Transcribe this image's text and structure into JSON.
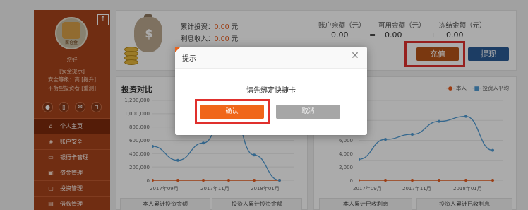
{
  "colors": {
    "sidebar": "#a8431b",
    "accent_orange": "#f0661a",
    "danger_red": "#e0302d",
    "withdraw_blue": "#2a5c96",
    "series_self": "#e85a1c",
    "series_avg": "#4f9bd4"
  },
  "sidebar": {
    "avatar_text": "聚仓金",
    "greeting": "您好",
    "security_notice": "[安全提示]",
    "security_level": "安全等级：高 [提升]",
    "investor_type": "平衡型投资者 [重测]",
    "quick_icons": [
      "user-icon",
      "phone-icon",
      "mail-icon",
      "lock-icon"
    ],
    "menu": [
      {
        "label": "个人主页",
        "icon": "home-icon",
        "active": true
      },
      {
        "label": "账户安全",
        "icon": "shield-icon",
        "active": false
      },
      {
        "label": "银行卡管理",
        "icon": "card-icon",
        "active": false
      },
      {
        "label": "资金管理",
        "icon": "wallet-icon",
        "active": false
      },
      {
        "label": "投资管理",
        "icon": "monitor-icon",
        "active": false
      },
      {
        "label": "借款管理",
        "icon": "doc-icon",
        "active": false
      }
    ]
  },
  "summary": {
    "cumulative_label": "累计投资：",
    "cumulative_value": "0.00",
    "interest_label": "利息收入：",
    "interest_value": "0.00",
    "unit": "元"
  },
  "account": {
    "balance_label": "账户余额（元）",
    "available_label": "可用金额（元）",
    "frozen_label": "冻结金额（元）",
    "balance": "0.00",
    "available": "0.00",
    "frozen": "0.00",
    "eq": "=",
    "plus": "+",
    "recharge_label": "充值",
    "withdraw_label": "提现"
  },
  "chart_left": {
    "title": "投资对比",
    "footer_tabs": [
      "本人累计投资金额",
      "投资人累计投资金额"
    ]
  },
  "chart_right": {
    "footer_tabs": [
      "本人累计已收利息",
      "投资人累计已收利息"
    ]
  },
  "legend": {
    "self": "本人",
    "avg": "投资人平均"
  },
  "chart_data": [
    {
      "type": "line",
      "x": [
        "2017年09月",
        "2017年10月",
        "2017年11月",
        "2017年12月",
        "2018年01月",
        "2018年02月"
      ],
      "tick_x": [
        "2017年09月",
        "2017年11月",
        "2018年01月"
      ],
      "yticks": [
        "1,200,000",
        "1,000,000",
        "800,000",
        "600,000",
        "400,000",
        "200,000",
        "0"
      ],
      "ylim": [
        0,
        1200000
      ],
      "series": [
        {
          "name": "本人",
          "values": [
            0,
            0,
            0,
            0,
            0,
            0
          ]
        },
        {
          "name": "投资人平均",
          "values": [
            510000,
            300000,
            560000,
            1150000,
            380000,
            0
          ]
        }
      ]
    },
    {
      "type": "line",
      "x": [
        "2017年09月",
        "2017年10月",
        "2017年11月",
        "2017年12月",
        "2018年01月",
        "2018年02月"
      ],
      "tick_x": [
        "2017年09月",
        "2017年11月",
        "2018年01月"
      ],
      "yticks": [
        "6,000",
        "4,000",
        "2,000",
        "0"
      ],
      "ylim": [
        0,
        8000
      ],
      "series": [
        {
          "name": "本人",
          "values": [
            0,
            0,
            0,
            0,
            0,
            0
          ]
        },
        {
          "name": "投资人平均",
          "values": [
            2100,
            4100,
            4600,
            5900,
            6400,
            3000
          ]
        }
      ]
    }
  ],
  "modal": {
    "title": "提示",
    "message": "请先绑定快捷卡",
    "confirm_label": "确认",
    "cancel_label": "取消",
    "close_glyph": "✕"
  }
}
